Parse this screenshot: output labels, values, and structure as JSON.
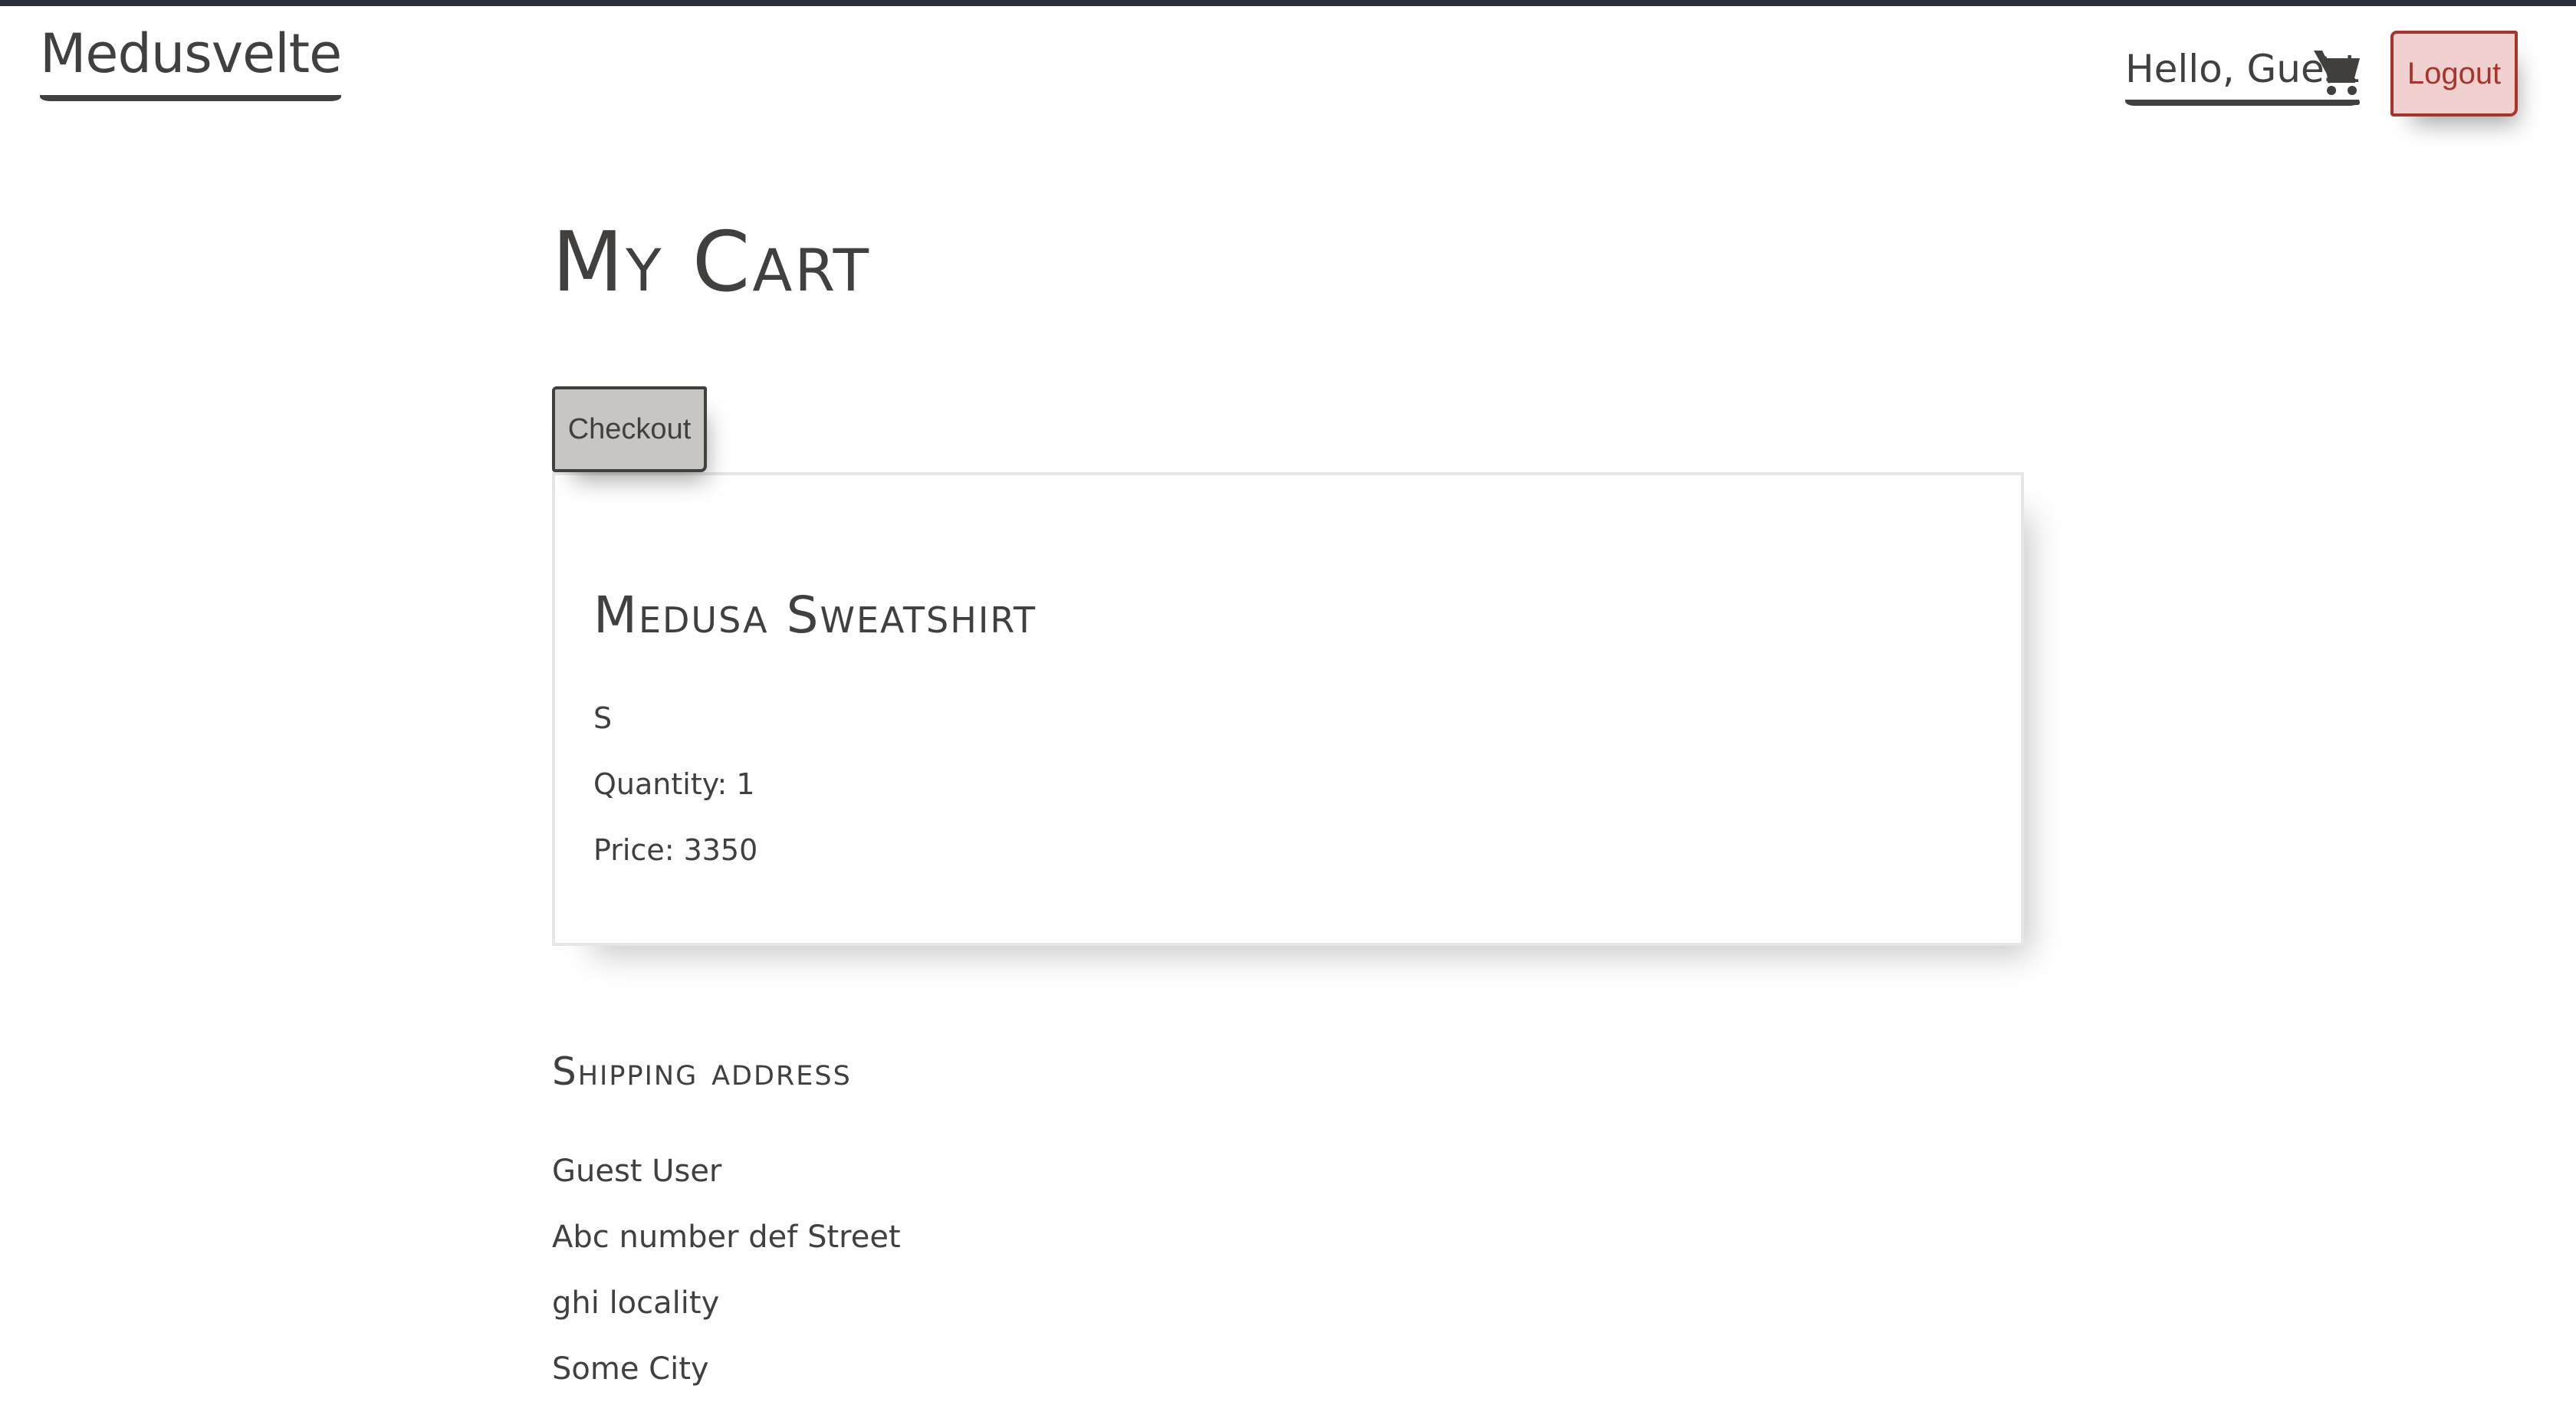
{
  "nav": {
    "brand": "Medusvelte",
    "greeting": "Hello, Guest",
    "cart_icon": "shopping-cart-icon",
    "logout_label": "Logout"
  },
  "page": {
    "title": "My Cart",
    "checkout_label": "Checkout"
  },
  "cart": {
    "items": [
      {
        "name": "Medusa Sweatshirt",
        "variant": "S",
        "quantity_text": "Quantity: 1",
        "price_text": "Price: 3350"
      }
    ]
  },
  "shipping": {
    "title": "Shipping address",
    "lines": [
      "Guest User",
      "Abc number def Street",
      "ghi locality",
      "Some City"
    ]
  },
  "colors": {
    "text": "#41403e",
    "top_stripe": "#2c2f3a",
    "logout_bg": "#f1d1d0",
    "logout_border": "#a7342d",
    "checkout_bg": "#c7c6c3"
  }
}
